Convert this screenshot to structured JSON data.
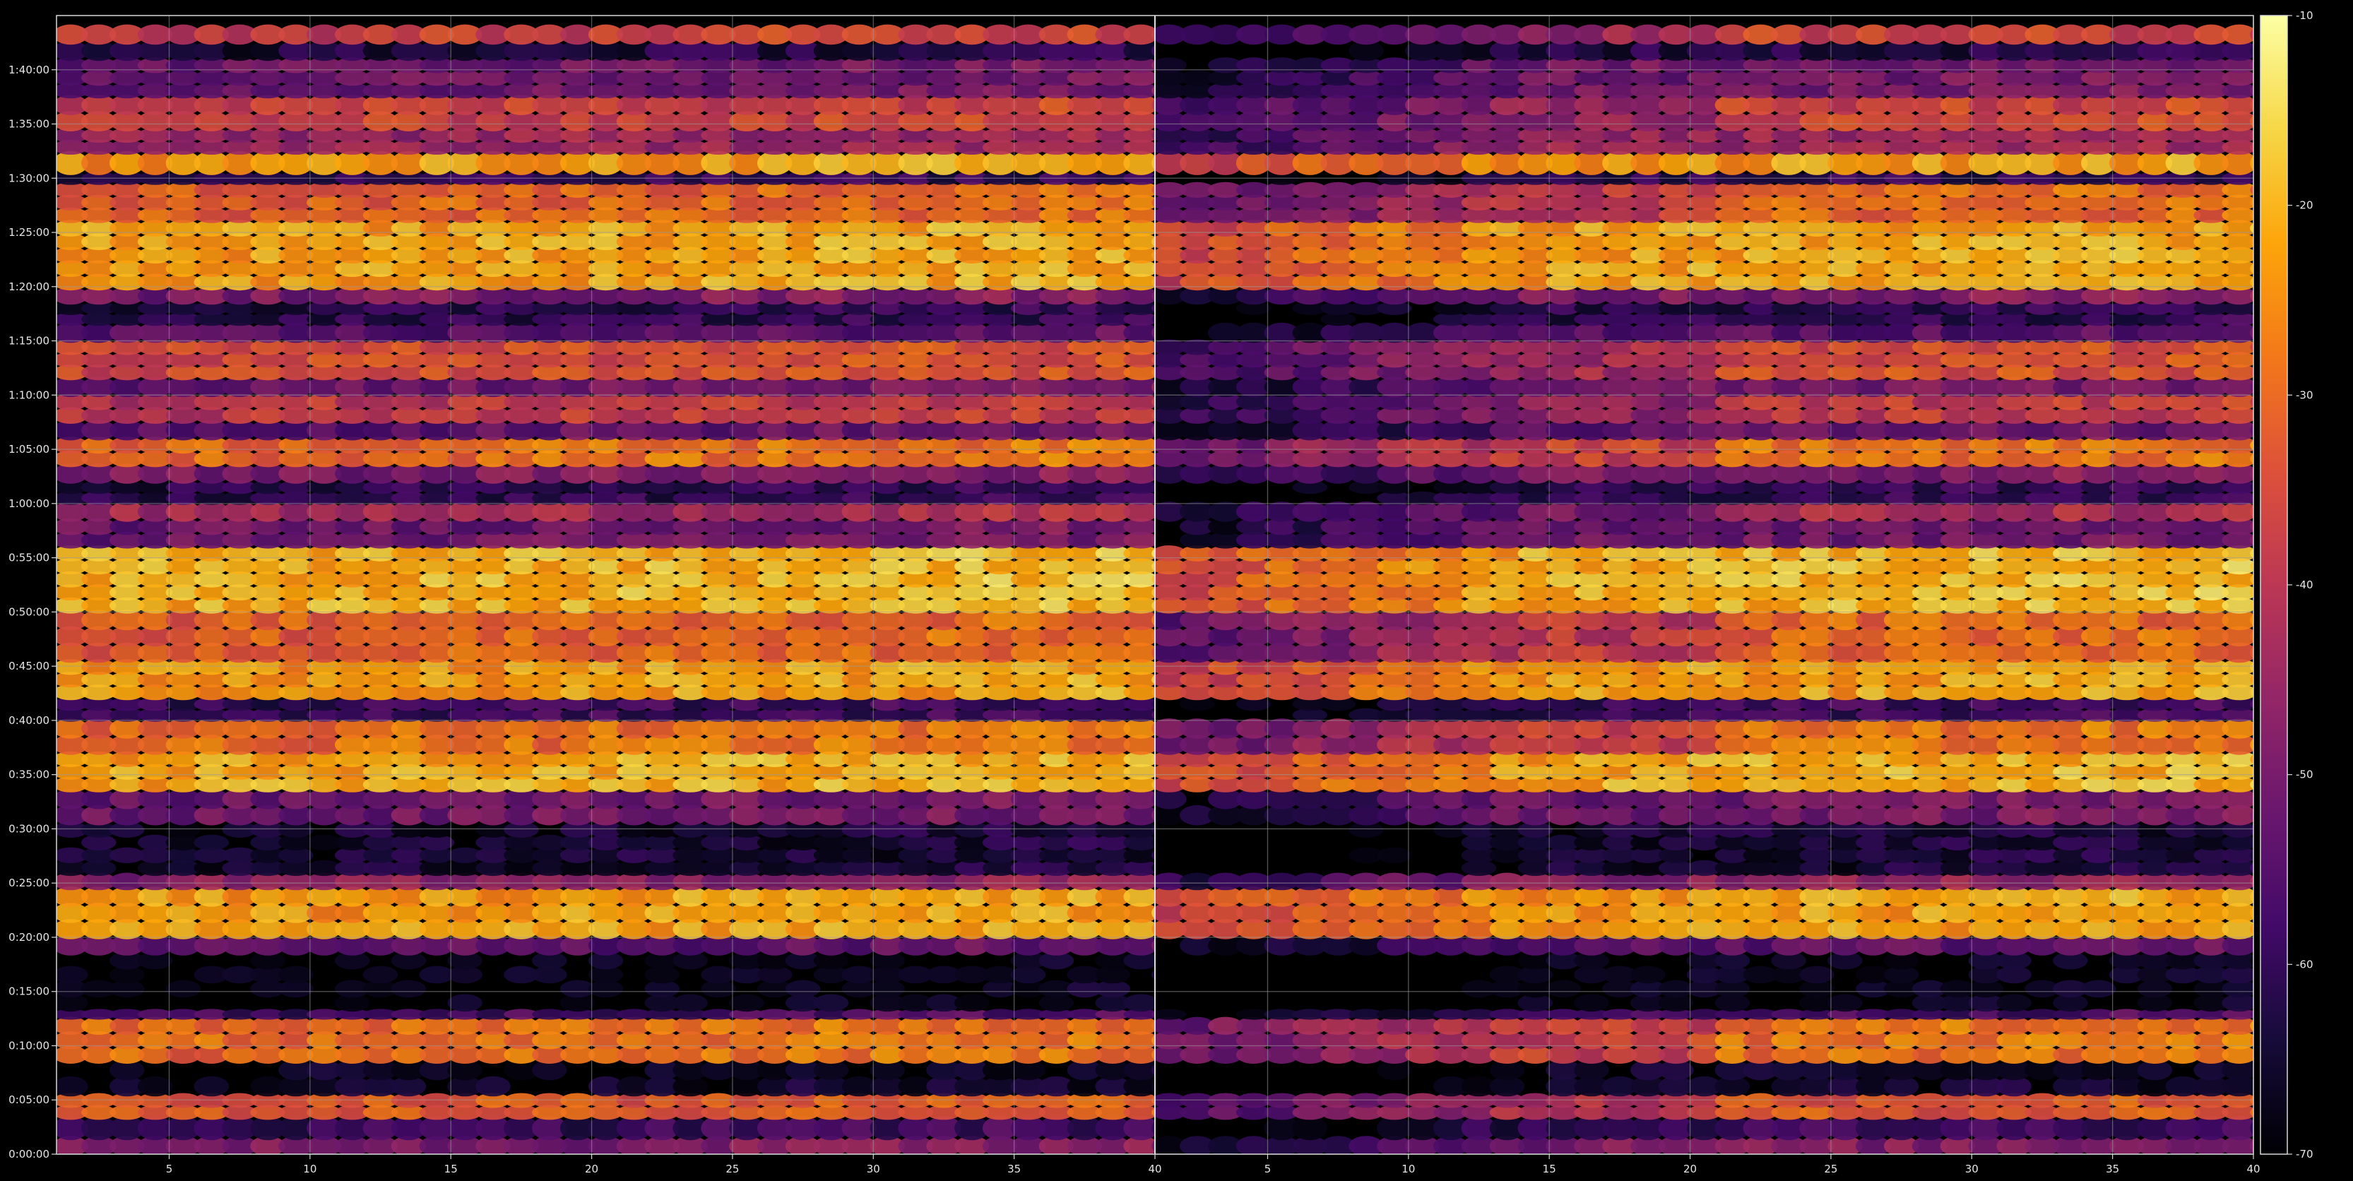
{
  "chart_data": {
    "type": "heatmap",
    "title": "",
    "xlabel": "",
    "ylabel": "",
    "colormap": "inferno",
    "background": "#000000",
    "grid": true,
    "panels": [
      {
        "name": "",
        "xlim": [
          1,
          40
        ],
        "xticks": [
          5,
          10,
          15,
          20,
          25,
          30,
          35,
          40
        ],
        "xtick_labels": [
          "5",
          "10",
          "15",
          "20",
          "25",
          "30",
          "35",
          "40"
        ]
      },
      {
        "name": "",
        "xlim": [
          1,
          40
        ],
        "xticks": [
          5,
          10,
          15,
          20,
          25,
          30,
          35,
          40
        ],
        "xtick_labels": [
          "5",
          "10",
          "15",
          "20",
          "25",
          "30",
          "35",
          "40"
        ]
      }
    ],
    "y_unit": "minutes",
    "ylim": [
      0,
      105
    ],
    "yticks": [
      0,
      5,
      10,
      15,
      20,
      25,
      30,
      35,
      40,
      45,
      50,
      55,
      60,
      65,
      70,
      75,
      80,
      85,
      90,
      95,
      100
    ],
    "ytick_labels": [
      "0:00:00",
      "0:05:00",
      "0:10:00",
      "0:15:00",
      "0:20:00",
      "0:25:00",
      "0:30:00",
      "0:35:00",
      "0:40:00",
      "0:45:00",
      "0:50:00",
      "0:55:00",
      "1:00:00",
      "1:05:00",
      "1:10:00",
      "1:15:00",
      "1:20:00",
      "1:25:00",
      "1:30:00",
      "1:35:00",
      "1:40:00"
    ],
    "colorbar": {
      "range": [
        -70,
        -10
      ],
      "ticks": [
        -10,
        -20,
        -30,
        -40,
        -50,
        -60,
        -70
      ],
      "tick_labels": [
        "-10",
        "-20",
        "-30",
        "-40",
        "-50",
        "-60",
        "-70"
      ]
    },
    "band_profile": [
      {
        "y0": 0.0,
        "y1": 1.5,
        "level": -50
      },
      {
        "y0": 1.5,
        "y1": 3.3,
        "level": -60
      },
      {
        "y0": 3.3,
        "y1": 5.5,
        "level": -34
      },
      {
        "y0": 5.5,
        "y1": 8.5,
        "level": -68
      },
      {
        "y0": 8.5,
        "y1": 12.5,
        "level": -30
      },
      {
        "y0": 12.5,
        "y1": 13.3,
        "level": -58
      },
      {
        "y0": 13.3,
        "y1": 18.5,
        "level": -70
      },
      {
        "y0": 18.5,
        "y1": 20.0,
        "level": -55
      },
      {
        "y0": 20.0,
        "y1": 24.5,
        "level": -24
      },
      {
        "y0": 24.5,
        "y1": 25.8,
        "level": -48
      },
      {
        "y0": 25.8,
        "y1": 30.5,
        "level": -66
      },
      {
        "y0": 30.5,
        "y1": 33.5,
        "level": -52
      },
      {
        "y0": 33.5,
        "y1": 37.0,
        "level": -22
      },
      {
        "y0": 37.0,
        "y1": 40.0,
        "level": -30
      },
      {
        "y0": 40.0,
        "y1": 42.0,
        "level": -60
      },
      {
        "y0": 42.0,
        "y1": 45.5,
        "level": -24
      },
      {
        "y0": 45.5,
        "y1": 50.0,
        "level": -32
      },
      {
        "y0": 50.0,
        "y1": 56.0,
        "level": -21
      },
      {
        "y0": 56.0,
        "y1": 58.5,
        "level": -52
      },
      {
        "y0": 58.5,
        "y1": 60.0,
        "level": -44
      },
      {
        "y0": 60.0,
        "y1": 62.0,
        "level": -62
      },
      {
        "y0": 62.0,
        "y1": 63.5,
        "level": -50
      },
      {
        "y0": 63.5,
        "y1": 66.0,
        "level": -30
      },
      {
        "y0": 66.0,
        "y1": 67.5,
        "level": -54
      },
      {
        "y0": 67.5,
        "y1": 70.0,
        "level": -40
      },
      {
        "y0": 70.0,
        "y1": 71.5,
        "level": -52
      },
      {
        "y0": 71.5,
        "y1": 75.0,
        "level": -36
      },
      {
        "y0": 75.0,
        "y1": 76.5,
        "level": -56
      },
      {
        "y0": 76.5,
        "y1": 78.5,
        "level": -62
      },
      {
        "y0": 78.5,
        "y1": 79.8,
        "level": -50
      },
      {
        "y0": 79.8,
        "y1": 86.0,
        "level": -23
      },
      {
        "y0": 86.0,
        "y1": 89.5,
        "level": -32
      },
      {
        "y0": 89.5,
        "y1": 90.5,
        "level": -62
      },
      {
        "y0": 90.5,
        "y1": 92.3,
        "level": -24
      },
      {
        "y0": 92.3,
        "y1": 94.5,
        "level": -46
      },
      {
        "y0": 94.5,
        "y1": 97.5,
        "level": -38
      },
      {
        "y0": 97.5,
        "y1": 101.0,
        "level": -52
      },
      {
        "y0": 101.0,
        "y1": 102.5,
        "level": -64
      },
      {
        "y0": 102.5,
        "y1": 104.0,
        "level": -38
      }
    ]
  }
}
